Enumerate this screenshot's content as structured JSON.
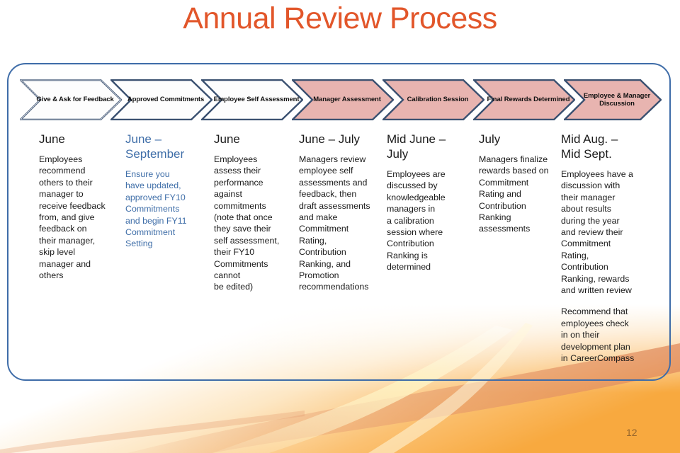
{
  "slide": {
    "title": "Annual Review Process",
    "title_color": "#E2562A",
    "page_number": "12",
    "frame_border_color": "#3E6CA8"
  },
  "process_steps": [
    {
      "label": "Give & Ask for\nFeedback",
      "fill": "#FDFDFD",
      "stroke": "#3A5070"
    },
    {
      "label": "Approved\nCommitments",
      "fill": "#FDFDFD",
      "stroke": "#3A5070"
    },
    {
      "label": "Employee Self\nAssessment",
      "fill": "#FDFDFD",
      "stroke": "#3A5070"
    },
    {
      "label": "Manager\nAssessment",
      "fill": "#E8B4B0",
      "stroke": "#3A5070"
    },
    {
      "label": "Calibration\nSession",
      "fill": "#E8B4B0",
      "stroke": "#3A5070"
    },
    {
      "label": "Final Rewards\nDetermined",
      "fill": "#E8B4B0",
      "stroke": "#3A5070"
    },
    {
      "label": "Employee &\nManager\nDiscussion",
      "fill": "#E8B4B0",
      "stroke": "#3A5070"
    }
  ],
  "columns": [
    {
      "timing": "June",
      "accent": false,
      "paragraphs": [
        "Employees\nrecommend\nothers to their\nmanager to\nreceive feedback\nfrom, and give\nfeedback on\ntheir manager,\nskip level\nmanager and\nothers"
      ]
    },
    {
      "timing": "June –\nSeptember",
      "accent": true,
      "paragraphs": [
        "Ensure you\nhave updated,\napproved FY10\nCommitments\nand begin FY11\nCommitment\nSetting"
      ]
    },
    {
      "timing": "June",
      "accent": false,
      "paragraphs": [
        "Employees\nassess their\nperformance\nagainst\ncommitments\n(note that once\nthey save their\nself assessment,\ntheir FY10\nCommitments\ncannot\nbe edited)"
      ]
    },
    {
      "timing": "June – July",
      "accent": false,
      "paragraphs": [
        "Managers review\nemployee self\nassessments and\nfeedback, then\ndraft assessments\nand  make\nCommitment\nRating,\nContribution\nRanking, and\nPromotion\nrecommendations"
      ]
    },
    {
      "timing": "Mid June –\nJuly",
      "accent": false,
      "paragraphs": [
        "Employees are\ndiscussed by\nknowledgeable\nmanagers in\na calibration\nsession where\nContribution\nRanking is\ndetermined"
      ]
    },
    {
      "timing": "July",
      "accent": false,
      "paragraphs": [
        "Managers finalize\nrewards based on\nCommitment\nRating and\nContribution\nRanking\nassessments"
      ]
    },
    {
      "timing": "Mid Aug. –\nMid Sept.",
      "accent": false,
      "paragraphs": [
        "Employees have a\ndiscussion with\ntheir manager\nabout results\nduring the year\nand review their\nCommitment\nRating,\nContribution\nRanking, rewards\nand written review",
        "Recommend that\nemployees check\nin on their\ndevelopment plan\nin CareerCompass"
      ]
    }
  ]
}
